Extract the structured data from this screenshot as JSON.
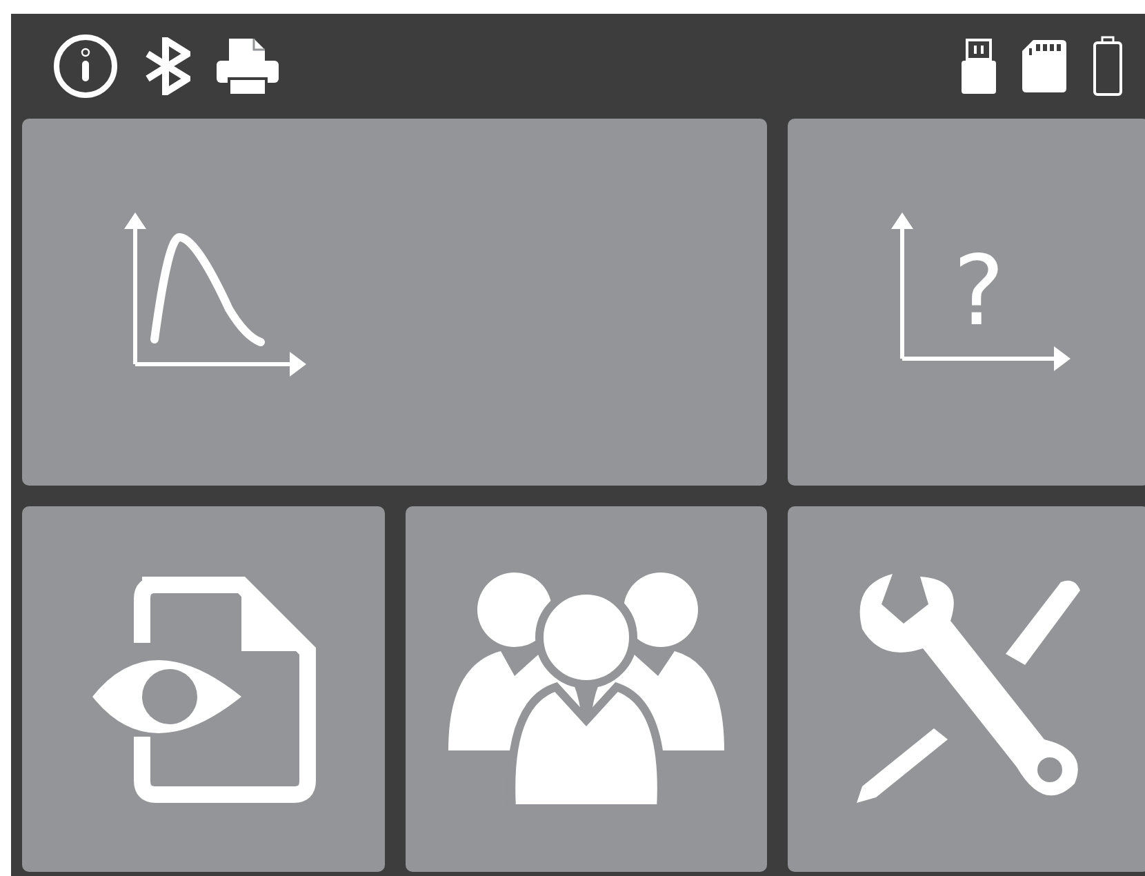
{
  "status_bar": {
    "left": [
      {
        "kind": "info"
      },
      {
        "kind": "bluetooth"
      },
      {
        "kind": "printer"
      }
    ],
    "right": [
      {
        "kind": "usb"
      },
      {
        "kind": "sd-card"
      },
      {
        "kind": "battery"
      }
    ]
  },
  "tiles": [
    {
      "kind": "decay-chart"
    },
    {
      "kind": "unknown-chart",
      "symbol": "?"
    },
    {
      "kind": "document-view"
    },
    {
      "kind": "users"
    },
    {
      "kind": "tools"
    }
  ]
}
